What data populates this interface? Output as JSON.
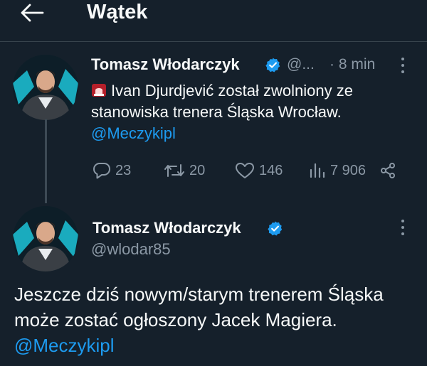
{
  "header": {
    "title": "Wątek",
    "back_icon": "arrow-left-icon"
  },
  "reply_tweet": {
    "author_name": "Tomasz Włodarczyk",
    "handle": "@...",
    "time": "· 8 min",
    "siren_icon": "rotating-light-emoji",
    "text": "Ivan Djurdjević został zwolniony ze stanowiska trenera Śląska Wrocław.",
    "mention": "@Meczykipl",
    "stats": {
      "replies": "23",
      "retweets": "20",
      "likes": "146",
      "views": "7 906"
    }
  },
  "main_tweet": {
    "author_name": "Tomasz Włodarczyk",
    "handle": "@wlodar85",
    "text": "Jeszcze dziś nowym/starym trenerem Śląska może zostać ogłoszony Jacek Magiera.",
    "mention": "@Meczykipl"
  },
  "colors": {
    "background": "#15202b",
    "accent": "#1d9bf0",
    "muted": "#8b98a5",
    "verified": "#1d9bf0"
  }
}
